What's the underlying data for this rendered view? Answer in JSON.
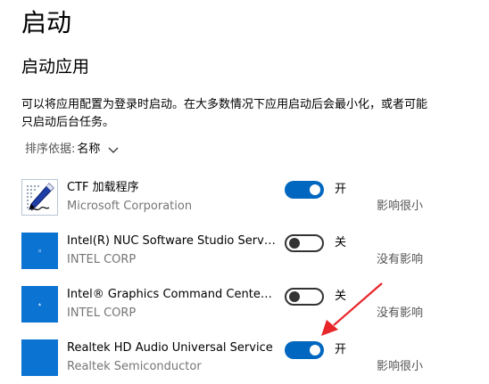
{
  "page": {
    "title": "启动",
    "section_title": "启动应用",
    "description": "可以将应用配置为登录时启动。在大多数情况下应用启动后会最小化，或者可能只启动后台任务。"
  },
  "sort": {
    "label": "排序依据:",
    "value": "名称",
    "icon": "chevron-down-icon"
  },
  "apps": [
    {
      "name": "CTF 加载程序",
      "publisher": "Microsoft Corporation",
      "enabled": true,
      "state_label": "开",
      "impact": "影响很小",
      "icon": "ctf-loader-icon"
    },
    {
      "name": "Intel(R) NUC Software Studio Service",
      "publisher": "INTEL CORP",
      "enabled": false,
      "state_label": "关",
      "impact": "没有影响",
      "icon": "app-tile-icon"
    },
    {
      "name": "Intel® Graphics Command Center S...",
      "publisher": "INTEL CORP",
      "enabled": false,
      "state_label": "关",
      "impact": "没有影响",
      "icon": "app-tile-icon"
    },
    {
      "name": "Realtek HD Audio Universal Service",
      "publisher": "Realtek Semiconductor",
      "enabled": true,
      "state_label": "开",
      "impact": "影响很小",
      "icon": "app-tile-icon"
    }
  ],
  "colors": {
    "toggle_on": "#0067c0",
    "app_tile": "#0b73d2",
    "annotation_arrow": "#e8262a"
  }
}
